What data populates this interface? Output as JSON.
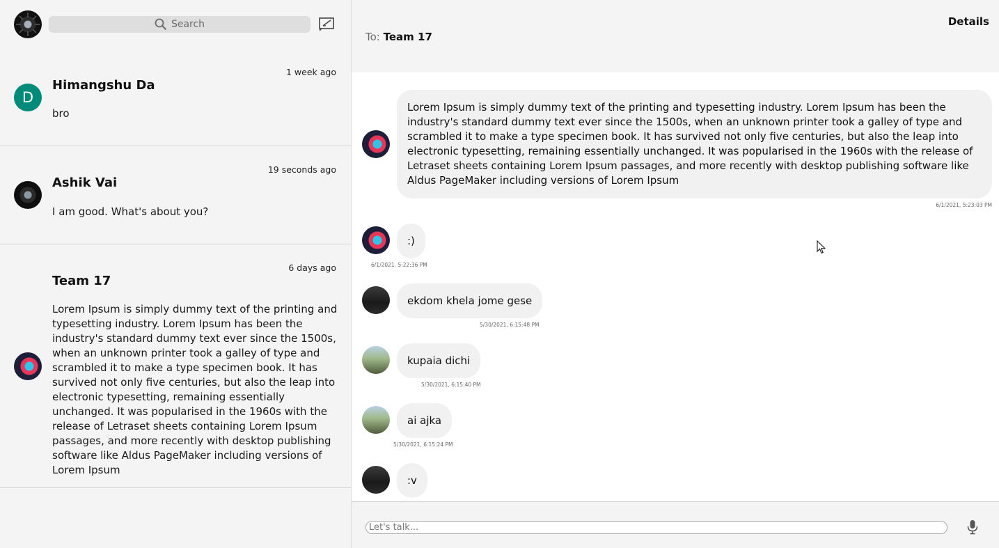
{
  "sidebar": {
    "search_label": "Search",
    "conversations": [
      {
        "name": "Himangshu Da",
        "time": "1 week ago",
        "message": "bro",
        "avatar_letter": "D"
      },
      {
        "name": "Ashik Vai",
        "time": "19 seconds ago",
        "message": "I am good. What's about you?"
      },
      {
        "name": "Team 17",
        "time": "6 days ago",
        "message": "Lorem Ipsum is simply dummy text of the printing and typesetting industry. Lorem Ipsum has been the industry's standard dummy text ever since the 1500s, when an unknown printer took a galley of type and scrambled it to make a type specimen book. It has survived not only five centuries, but also the leap into electronic typesetting, remaining essentially unchanged. It was popularised in the 1960s with the release of Letraset sheets containing Lorem Ipsum passages, and more recently with desktop publishing software like Aldus PageMaker including versions of Lorem Ipsum"
      }
    ]
  },
  "chat": {
    "to_label": "To:",
    "to_name": "Team 17",
    "details_label": "Details",
    "messages": [
      {
        "text": "Lorem Ipsum is simply dummy text of the printing and typesetting industry. Lorem Ipsum has been the industry's standard dummy text ever since the 1500s, when an unknown printer took a galley of type and scrambled it to make a type specimen book. It has survived not only five centuries, but also the leap into electronic typesetting, remaining essentially unchanged. It was popularised in the 1960s with the release of Letraset sheets containing Lorem Ipsum passages, and more recently with desktop publishing software like Aldus PageMaker including versions of Lorem Ipsum",
        "timestamp": "6/1/2021, 5:23:03 PM"
      },
      {
        "text": ":)",
        "timestamp": "6/1/2021, 5:22:36 PM"
      },
      {
        "text": "ekdom khela jome gese",
        "timestamp": "5/30/2021, 6:15:48 PM"
      },
      {
        "text": "kupaia dichi",
        "timestamp": "5/30/2021, 6:15:40 PM"
      },
      {
        "text": "ai ajka",
        "timestamp": "5/30/2021, 6:15:24 PM"
      },
      {
        "text": ":v"
      }
    ],
    "composer_placeholder": "Let's talk..."
  },
  "icons": {
    "search": "search-icon",
    "compose": "compose-icon",
    "mic": "mic-icon",
    "cursor": "mouse-cursor-icon"
  },
  "colors": {
    "sidebar_bg": "#f4f4f4",
    "bubble_bg": "#f1f1f1",
    "letter_avatar": "#008a7a"
  }
}
